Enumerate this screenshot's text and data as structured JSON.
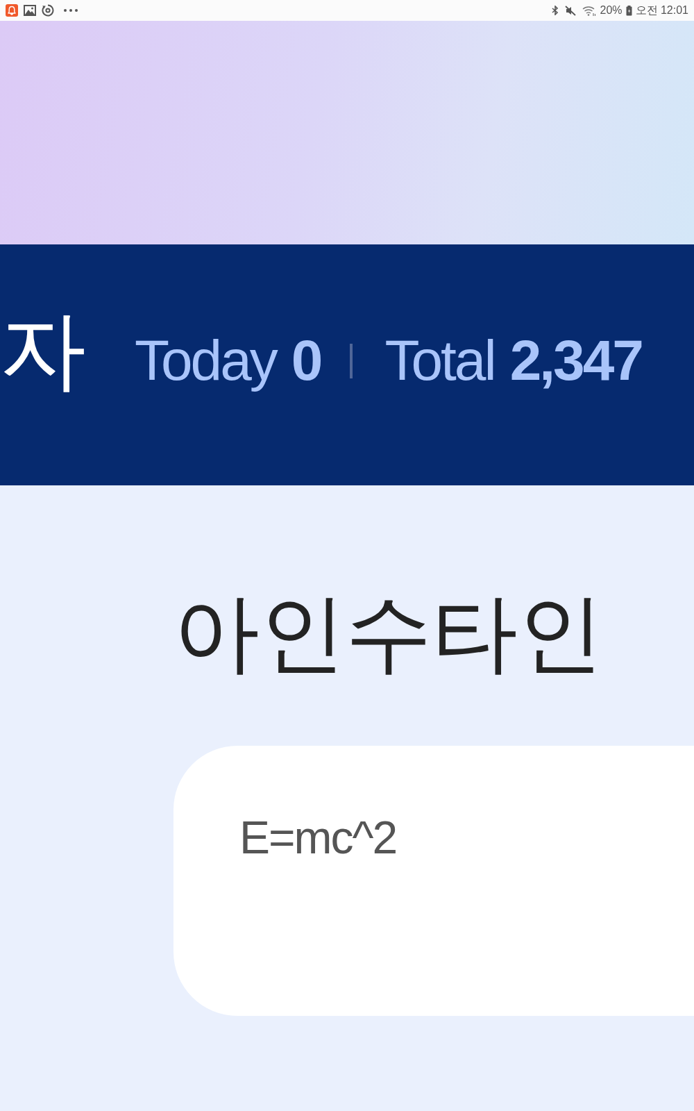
{
  "status_bar": {
    "battery": "20%",
    "time": "오전 12:01"
  },
  "visitor_bar": {
    "label": "자",
    "today_label": "Today",
    "today_count": "0",
    "total_label": "Total",
    "total_count": "2,347"
  },
  "title": "아인수타인",
  "card": {
    "text": "E=mc^2"
  }
}
